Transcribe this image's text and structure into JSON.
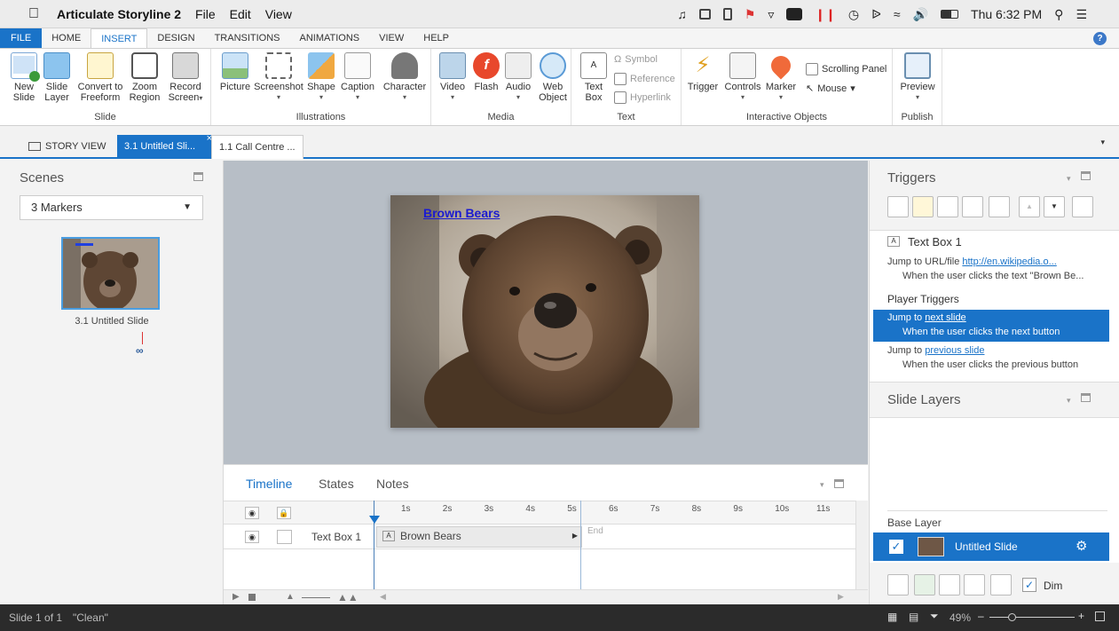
{
  "mac_menubar": {
    "app_name": "Articulate Storyline 2",
    "menus": [
      "File",
      "Edit",
      "View"
    ],
    "clock": "Thu 6:32 PM"
  },
  "ribbon_tabs": [
    "FILE",
    "HOME",
    "INSERT",
    "DESIGN",
    "TRANSITIONS",
    "ANIMATIONS",
    "VIEW",
    "HELP"
  ],
  "active_ribbon_tab": "INSERT",
  "help_label": "?",
  "ribbon": {
    "slide_group": {
      "label": "Slide",
      "buttons": [
        "New\nSlide",
        "Slide\nLayer",
        "Convert to\nFreeform",
        "Zoom\nRegion",
        "Record\nScreen"
      ]
    },
    "illustrations_group": {
      "label": "Illustrations",
      "buttons": [
        "Picture",
        "Screenshot",
        "Shape",
        "Caption",
        "Character"
      ]
    },
    "media_group": {
      "label": "Media",
      "buttons": [
        "Video",
        "Flash",
        "Audio",
        "Web\nObject"
      ]
    },
    "text_group": {
      "label": "Text",
      "text_box": "Text\nBox",
      "symbol": "Symbol",
      "reference": "Reference",
      "hyperlink": "Hyperlink"
    },
    "interactive_group": {
      "label": "Interactive Objects",
      "buttons": [
        "Trigger",
        "Controls",
        "Marker"
      ],
      "scrolling_panel": "Scrolling Panel",
      "mouse": "Mouse"
    },
    "publish_group": {
      "label": "Publish",
      "preview": "Preview"
    }
  },
  "doc_tabs": {
    "story_view": "STORY VIEW",
    "active": "3.1 Untitled Sli...",
    "other": "1.1 Call Centre ..."
  },
  "scenes": {
    "title": "Scenes",
    "dropdown_value": "3 Markers",
    "slide_label": "3.1 Untitled Slide"
  },
  "slide": {
    "link_text": "Brown Bears"
  },
  "timeline": {
    "tabs": [
      "Timeline",
      "States",
      "Notes"
    ],
    "ticks": [
      "1s",
      "2s",
      "3s",
      "4s",
      "5s",
      "6s",
      "7s",
      "8s",
      "9s",
      "10s",
      "11s"
    ],
    "row_name": "Text Box 1",
    "row_bar_label": "Brown Bears",
    "end_label": "End"
  },
  "triggers": {
    "title": "Triggers",
    "object_name": "Text Box 1",
    "t1_prefix": "Jump to URL/file",
    "t1_link": "http://en.wikipedia.o...",
    "t1_cond": "When the user clicks the text \"Brown Be...",
    "player_title": "Player Triggers",
    "t2_prefix": "Jump to",
    "t2_link": "next slide",
    "t2_cond": "When the user clicks the next button",
    "t3_prefix": "Jump to",
    "t3_link": "previous slide",
    "t3_cond": "When the user clicks the previous button"
  },
  "layers": {
    "title": "Slide Layers",
    "base_layer": "Base Layer",
    "layer_name": "Untitled Slide",
    "dim_label": "Dim"
  },
  "status_bar": {
    "slide_info": "Slide 1 of 1",
    "theme": "\"Clean\"",
    "zoom": "49%"
  }
}
